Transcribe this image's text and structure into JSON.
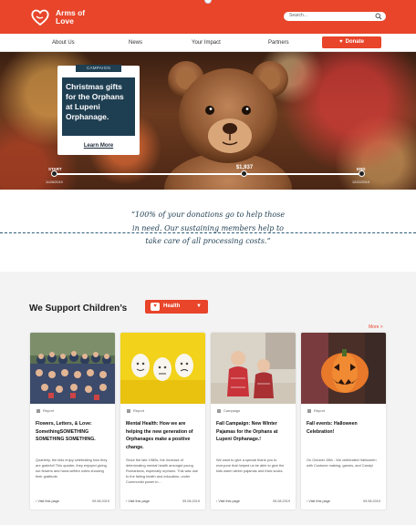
{
  "header": {
    "logo_name": "heart-hand-logo",
    "logo_line1": "Arms of",
    "logo_line2": "Love",
    "search_placeholder": "Search...",
    "brand_color": "#e8452a"
  },
  "nav": {
    "items": [
      "About Us",
      "News",
      "Your Impact",
      "Partners"
    ],
    "donate_label": "Donate"
  },
  "hero": {
    "tag": "CAMPAIGN",
    "title": "Christmas gifts for the Orphans at Lupeni Orphanage.",
    "link": "Learn More",
    "start_label": "START",
    "end_label": "END",
    "start_date": "11/26/2019",
    "end_date": "12/22/2019",
    "amount": "$1,937",
    "progress": 0.62
  },
  "quote": {
    "line1": "“100% of your donations go to help those",
    "line2": "in need. Our sustaining members help to",
    "line3": "take care of all processing costs.”"
  },
  "section": {
    "title": "We Support Children’s",
    "filter_label": "Health",
    "more_label": "More"
  },
  "cards": [
    {
      "type": "Report",
      "title": "Flowers, Letters, & Love: SomethingSOMETHING SOMETHING SOMETHING.",
      "desc": "Quarterly, the kids enjoy celebrating how they are grateful! This quarter, they enjoyed giving out flowers and hand-written notes showing their gratitude.",
      "link": "Visit this page",
      "date": "09.08.2019"
    },
    {
      "type": "Report",
      "title": "Mental Health: How we are helping the new generation of Orphanages make a positive change.",
      "desc": "Since the late 1980s, the increase of deteriorating mental health amongst young Romanians, especially orphans. This was due to the failing health and education, under Communist power in...",
      "link": "Visit this page",
      "date": "09.08.2019"
    },
    {
      "type": "Campaign",
      "title": "Fall Campaign: New Winter Pajamas for the Orphans at Lupeni Orphanage.!",
      "desc": "We want to give a special thank you to everyone that helped us be able to give the kids warm winter pajamas and thick socks.",
      "link": "Visit this page",
      "date": "09.08.2019"
    },
    {
      "type": "Report",
      "title": "Fall events: Halloween Celebration!",
      "desc": "On October 28th - We celebrated Halloween with Costume making, games, and Candy!",
      "link": "Visit this page",
      "date": "09.08.2019"
    }
  ]
}
